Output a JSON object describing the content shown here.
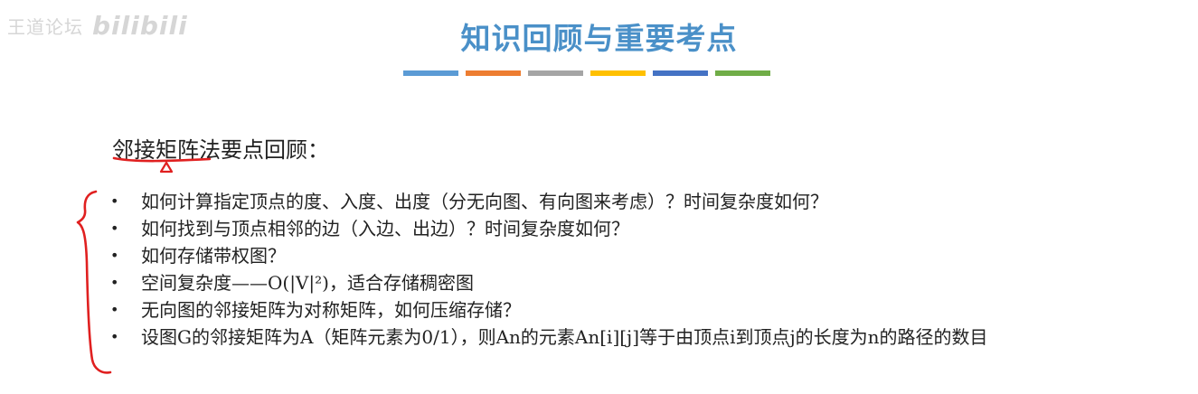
{
  "watermark": {
    "text": "王道论坛",
    "logo": "bilibili"
  },
  "title": "知识回顾与重要考点",
  "color_bars": [
    "#5b9bd5",
    "#ed7d31",
    "#a5a5a5",
    "#ffc000",
    "#4472c4",
    "#70ad47"
  ],
  "subtitle": "邻接矩阵法要点回顾：",
  "annotation_color": "#e02020",
  "points": [
    "如何计算指定顶点的度、入度、出度（分无向图、有向图来考虑）？时间复杂度如何？",
    "如何找到与顶点相邻的边（入边、出边）？时间复杂度如何？",
    "如何存储带权图？",
    "空间复杂度——O(|V|²)，适合存储稠密图",
    "无向图的邻接矩阵为对称矩阵，如何压缩存储？",
    "设图G的邻接矩阵为A（矩阵元素为0/1），则An的元素An[i][j]等于由顶点i到顶点j的长度为n的路径的数目"
  ],
  "bullet_char": "•"
}
